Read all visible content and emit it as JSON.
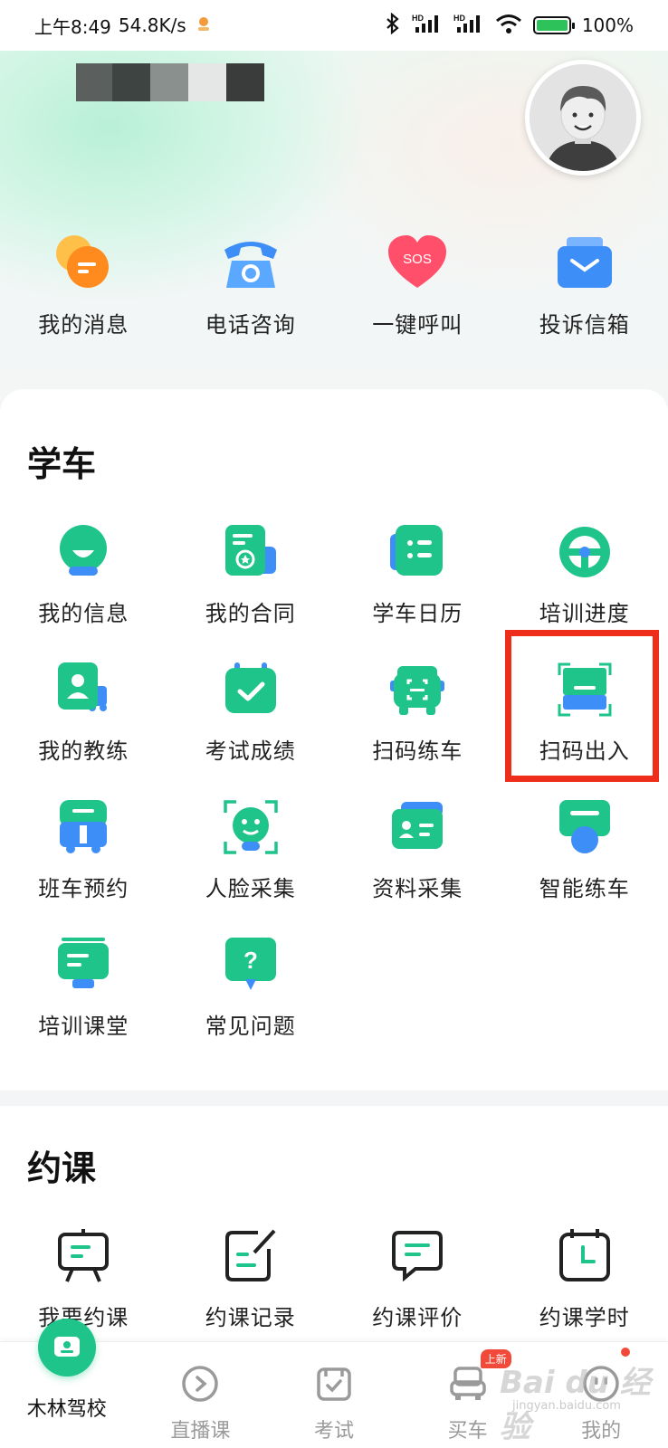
{
  "status_bar": {
    "time": "上午8:49",
    "speed": "54.8K/s",
    "battery_percent": "100%",
    "battery_level": 1.0,
    "hd1": "HD",
    "hd2": "HD",
    "icons": [
      "bluetooth-icon",
      "signal-icon",
      "signal-icon",
      "wifi-icon",
      "battery-icon"
    ]
  },
  "quick_actions": [
    {
      "label": "我的消息",
      "icon": "message-icon"
    },
    {
      "label": "电话咨询",
      "icon": "phone-icon"
    },
    {
      "label": "一键呼叫",
      "icon": "sos-icon",
      "icon_text": "SOS"
    },
    {
      "label": "投诉信箱",
      "icon": "mailbox-icon"
    }
  ],
  "learn_section": {
    "title": "学车",
    "items": [
      {
        "label": "我的信息",
        "icon": "user-info-icon"
      },
      {
        "label": "我的合同",
        "icon": "contract-icon"
      },
      {
        "label": "学车日历",
        "icon": "calendar-list-icon"
      },
      {
        "label": "培训进度",
        "icon": "steering-wheel-icon"
      },
      {
        "label": "我的教练",
        "icon": "coach-icon"
      },
      {
        "label": "考试成绩",
        "icon": "exam-result-icon"
      },
      {
        "label": "扫码练车",
        "icon": "scan-car-icon"
      },
      {
        "label": "扫码出入",
        "icon": "scan-entry-icon",
        "highlighted": true
      },
      {
        "label": "班车预约",
        "icon": "bus-icon"
      },
      {
        "label": "人脸采集",
        "icon": "face-scan-icon"
      },
      {
        "label": "资料采集",
        "icon": "id-card-icon"
      },
      {
        "label": "智能练车",
        "icon": "smart-practice-icon"
      },
      {
        "label": "培训课堂",
        "icon": "classroom-icon"
      },
      {
        "label": "常见问题",
        "icon": "faq-icon",
        "icon_text": "?"
      }
    ]
  },
  "booking_section": {
    "title": "约课",
    "items": [
      {
        "label": "我要约课",
        "icon": "book-lesson-icon"
      },
      {
        "label": "约课记录",
        "icon": "booking-record-icon"
      },
      {
        "label": "约课评价",
        "icon": "booking-review-icon"
      },
      {
        "label": "约课学时",
        "icon": "booking-hours-icon"
      }
    ]
  },
  "bottom_nav": [
    {
      "label": "木林驾校",
      "icon": "school-icon",
      "active": true
    },
    {
      "label": "直播课",
      "icon": "live-icon"
    },
    {
      "label": "考试",
      "icon": "exam-icon"
    },
    {
      "label": "买车",
      "icon": "car-icon",
      "badge": "上新"
    },
    {
      "label": "我的",
      "icon": "profile-icon",
      "dot": true
    }
  ],
  "watermark": {
    "text": "Bai du 经验",
    "sub": "jingyan.baidu.com"
  },
  "colors": {
    "accent_green": "#1fc48a",
    "icon_blue": "#3e8ef7",
    "highlight_red": "#ee2d1a",
    "badge_red": "#f24a3a"
  }
}
